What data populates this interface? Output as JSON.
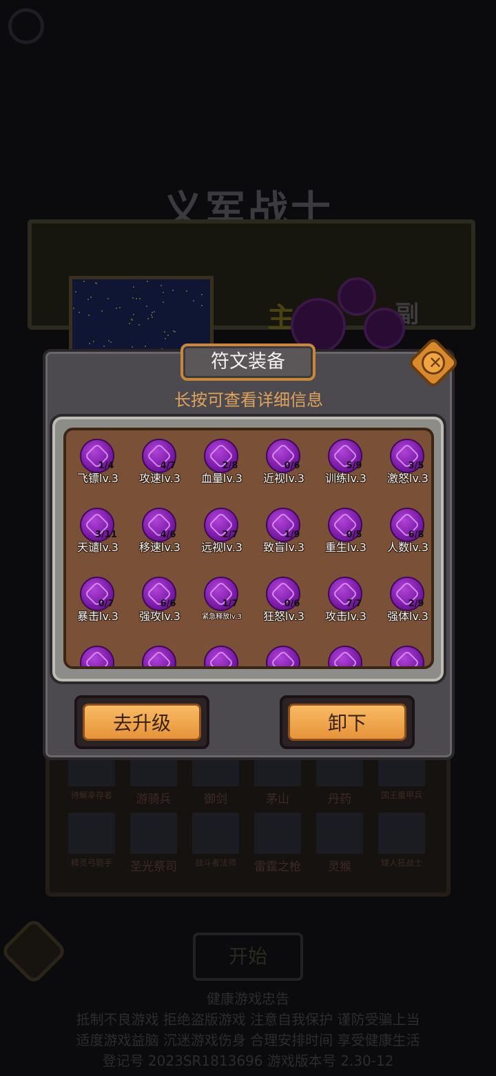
{
  "background": {
    "hero_name": "义军战士",
    "main_label": "主",
    "sub_label": "副",
    "units": [
      {
        "label": "待解幸存者"
      },
      {
        "label": "游骑兵"
      },
      {
        "label": "御剑"
      },
      {
        "label": "茅山"
      },
      {
        "label": "丹药"
      },
      {
        "label": "国王重甲兵"
      },
      {
        "label": "精灵弓箭手"
      },
      {
        "label": "圣光祭司"
      },
      {
        "label": "战斗者法师"
      },
      {
        "label": "雷霆之枪"
      },
      {
        "label": "灵猴"
      },
      {
        "label": "矮人狂战士"
      }
    ],
    "start_button": "开始",
    "notice_title": "健康游戏忠告",
    "notice_line1": "抵制不良游戏  拒绝盗版游戏  注意自我保护  谨防受骗上当",
    "notice_line2": "适度游戏益脑  沉迷游戏伤身  合理安排时间  享受健康生活",
    "notice_line3": "登记号  2023SR1813696  游戏版本号  2.30-12"
  },
  "dialog": {
    "title": "符文装备",
    "close_symbol": "✕",
    "hint": "长按可查看详细信息",
    "runes": [
      {
        "count": "1/4",
        "label": "飞镖lv.3"
      },
      {
        "count": "4/7",
        "label": "攻速lv.3"
      },
      {
        "count": "2/8",
        "label": "血量lv.3"
      },
      {
        "count": "0/6",
        "label": "近视lv.3"
      },
      {
        "count": "5/9",
        "label": "训练lv.3"
      },
      {
        "count": "3/5",
        "label": "激怒lv.3"
      },
      {
        "count": "3/11",
        "label": "天谴lv.3"
      },
      {
        "count": "4/6",
        "label": "移速lv.3"
      },
      {
        "count": "2/7",
        "label": "远视lv.3"
      },
      {
        "count": "1/9",
        "label": "致盲lv.3"
      },
      {
        "count": "0/5",
        "label": "重生lv.3"
      },
      {
        "count": "6/8",
        "label": "人数lv.3"
      },
      {
        "count": "0/7",
        "label": "暴击lv.3"
      },
      {
        "count": "6/6",
        "label": "强攻lv.3"
      },
      {
        "count": "1/7",
        "label": "紧急释放lv.3"
      },
      {
        "count": "0/6",
        "label": "狂怒lv.3"
      },
      {
        "count": "7/7",
        "label": "攻击lv.3"
      },
      {
        "count": "2/9",
        "label": "强体lv.3"
      }
    ],
    "upgrade_button": "去升级",
    "unequip_button": "卸下"
  }
}
